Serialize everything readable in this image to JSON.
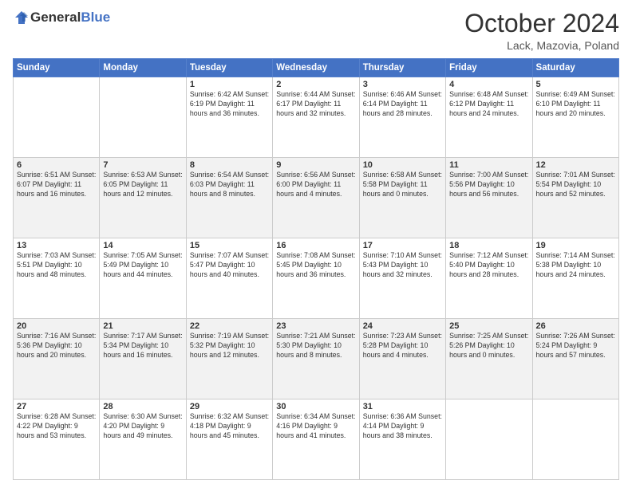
{
  "header": {
    "logo_general": "General",
    "logo_blue": "Blue",
    "month": "October 2024",
    "location": "Lack, Mazovia, Poland"
  },
  "weekdays": [
    "Sunday",
    "Monday",
    "Tuesday",
    "Wednesday",
    "Thursday",
    "Friday",
    "Saturday"
  ],
  "weeks": [
    [
      {
        "day": "",
        "info": ""
      },
      {
        "day": "",
        "info": ""
      },
      {
        "day": "1",
        "info": "Sunrise: 6:42 AM\nSunset: 6:19 PM\nDaylight: 11 hours and 36 minutes."
      },
      {
        "day": "2",
        "info": "Sunrise: 6:44 AM\nSunset: 6:17 PM\nDaylight: 11 hours and 32 minutes."
      },
      {
        "day": "3",
        "info": "Sunrise: 6:46 AM\nSunset: 6:14 PM\nDaylight: 11 hours and 28 minutes."
      },
      {
        "day": "4",
        "info": "Sunrise: 6:48 AM\nSunset: 6:12 PM\nDaylight: 11 hours and 24 minutes."
      },
      {
        "day": "5",
        "info": "Sunrise: 6:49 AM\nSunset: 6:10 PM\nDaylight: 11 hours and 20 minutes."
      }
    ],
    [
      {
        "day": "6",
        "info": "Sunrise: 6:51 AM\nSunset: 6:07 PM\nDaylight: 11 hours and 16 minutes."
      },
      {
        "day": "7",
        "info": "Sunrise: 6:53 AM\nSunset: 6:05 PM\nDaylight: 11 hours and 12 minutes."
      },
      {
        "day": "8",
        "info": "Sunrise: 6:54 AM\nSunset: 6:03 PM\nDaylight: 11 hours and 8 minutes."
      },
      {
        "day": "9",
        "info": "Sunrise: 6:56 AM\nSunset: 6:00 PM\nDaylight: 11 hours and 4 minutes."
      },
      {
        "day": "10",
        "info": "Sunrise: 6:58 AM\nSunset: 5:58 PM\nDaylight: 11 hours and 0 minutes."
      },
      {
        "day": "11",
        "info": "Sunrise: 7:00 AM\nSunset: 5:56 PM\nDaylight: 10 hours and 56 minutes."
      },
      {
        "day": "12",
        "info": "Sunrise: 7:01 AM\nSunset: 5:54 PM\nDaylight: 10 hours and 52 minutes."
      }
    ],
    [
      {
        "day": "13",
        "info": "Sunrise: 7:03 AM\nSunset: 5:51 PM\nDaylight: 10 hours and 48 minutes."
      },
      {
        "day": "14",
        "info": "Sunrise: 7:05 AM\nSunset: 5:49 PM\nDaylight: 10 hours and 44 minutes."
      },
      {
        "day": "15",
        "info": "Sunrise: 7:07 AM\nSunset: 5:47 PM\nDaylight: 10 hours and 40 minutes."
      },
      {
        "day": "16",
        "info": "Sunrise: 7:08 AM\nSunset: 5:45 PM\nDaylight: 10 hours and 36 minutes."
      },
      {
        "day": "17",
        "info": "Sunrise: 7:10 AM\nSunset: 5:43 PM\nDaylight: 10 hours and 32 minutes."
      },
      {
        "day": "18",
        "info": "Sunrise: 7:12 AM\nSunset: 5:40 PM\nDaylight: 10 hours and 28 minutes."
      },
      {
        "day": "19",
        "info": "Sunrise: 7:14 AM\nSunset: 5:38 PM\nDaylight: 10 hours and 24 minutes."
      }
    ],
    [
      {
        "day": "20",
        "info": "Sunrise: 7:16 AM\nSunset: 5:36 PM\nDaylight: 10 hours and 20 minutes."
      },
      {
        "day": "21",
        "info": "Sunrise: 7:17 AM\nSunset: 5:34 PM\nDaylight: 10 hours and 16 minutes."
      },
      {
        "day": "22",
        "info": "Sunrise: 7:19 AM\nSunset: 5:32 PM\nDaylight: 10 hours and 12 minutes."
      },
      {
        "day": "23",
        "info": "Sunrise: 7:21 AM\nSunset: 5:30 PM\nDaylight: 10 hours and 8 minutes."
      },
      {
        "day": "24",
        "info": "Sunrise: 7:23 AM\nSunset: 5:28 PM\nDaylight: 10 hours and 4 minutes."
      },
      {
        "day": "25",
        "info": "Sunrise: 7:25 AM\nSunset: 5:26 PM\nDaylight: 10 hours and 0 minutes."
      },
      {
        "day": "26",
        "info": "Sunrise: 7:26 AM\nSunset: 5:24 PM\nDaylight: 9 hours and 57 minutes."
      }
    ],
    [
      {
        "day": "27",
        "info": "Sunrise: 6:28 AM\nSunset: 4:22 PM\nDaylight: 9 hours and 53 minutes."
      },
      {
        "day": "28",
        "info": "Sunrise: 6:30 AM\nSunset: 4:20 PM\nDaylight: 9 hours and 49 minutes."
      },
      {
        "day": "29",
        "info": "Sunrise: 6:32 AM\nSunset: 4:18 PM\nDaylight: 9 hours and 45 minutes."
      },
      {
        "day": "30",
        "info": "Sunrise: 6:34 AM\nSunset: 4:16 PM\nDaylight: 9 hours and 41 minutes."
      },
      {
        "day": "31",
        "info": "Sunrise: 6:36 AM\nSunset: 4:14 PM\nDaylight: 9 hours and 38 minutes."
      },
      {
        "day": "",
        "info": ""
      },
      {
        "day": "",
        "info": ""
      }
    ]
  ]
}
